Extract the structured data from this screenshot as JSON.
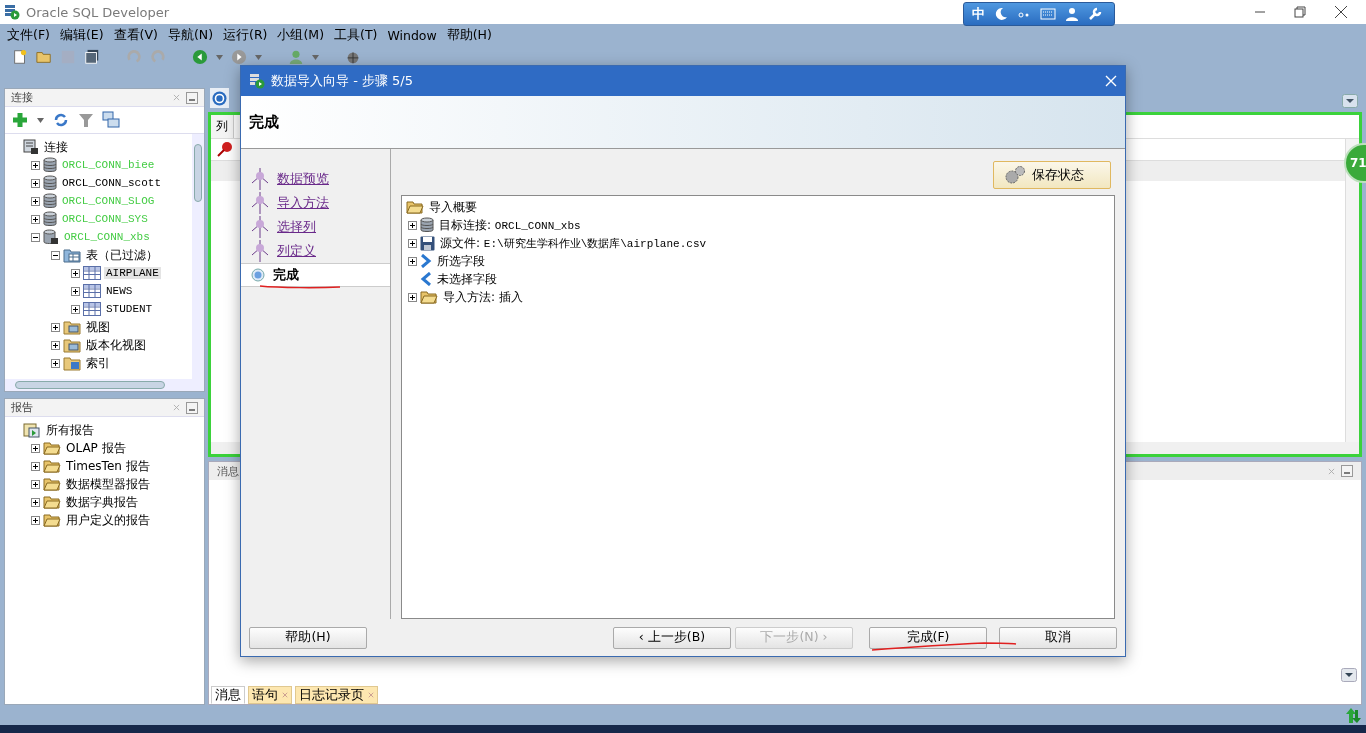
{
  "window": {
    "title": "Oracle SQL Developer"
  },
  "ime_bar": {
    "label": "中"
  },
  "menu": [
    "文件(F)",
    "编辑(E)",
    "查看(V)",
    "导航(N)",
    "运行(R)",
    "小组(M)",
    "工具(T)",
    "Window",
    "帮助(H)"
  ],
  "connections_panel": {
    "title": "连接",
    "tree": [
      {
        "label": "连接",
        "kind": "root",
        "selected": false,
        "children": [
          {
            "label": "ORCL_CONN_biee",
            "kind": "database",
            "expanded": false,
            "color": "#44cc44",
            "selected": false
          },
          {
            "label": "ORCL_CONN_scott",
            "kind": "database",
            "expanded": false,
            "color": "#000000",
            "selected": false
          },
          {
            "label": "ORCL_CONN_SLOG",
            "kind": "database",
            "expanded": false,
            "color": "#44cc44",
            "selected": false
          },
          {
            "label": "ORCL_CONN_SYS",
            "kind": "database",
            "expanded": false,
            "color": "#44cc44",
            "selected": false
          },
          {
            "label": "ORCL_CONN_xbs",
            "kind": "connection",
            "expanded": true,
            "color": "#44cc44",
            "selected": false,
            "children": [
              {
                "label": "表（已过滤）",
                "kind": "table-folder",
                "expanded": true,
                "selected": false,
                "children": [
                  {
                    "label": "AIRPLANE",
                    "kind": "table",
                    "expanded": false,
                    "selected": true
                  },
                  {
                    "label": "NEWS",
                    "kind": "table",
                    "expanded": false,
                    "selected": false
                  },
                  {
                    "label": "STUDENT",
                    "kind": "table",
                    "expanded": false,
                    "selected": false
                  }
                ]
              },
              {
                "label": "视图",
                "kind": "view-folder",
                "expanded": false,
                "selected": false
              },
              {
                "label": "版本化视图",
                "kind": "view-folder",
                "expanded": false,
                "selected": false
              },
              {
                "label": "索引",
                "kind": "index-folder",
                "expanded": false,
                "selected": false
              }
            ]
          }
        ]
      }
    ]
  },
  "reports_panel": {
    "title": "报告",
    "tree": [
      {
        "label": "所有报告",
        "kind": "report-root",
        "selected": false,
        "children": [
          {
            "label": "OLAP 报告",
            "kind": "folder",
            "expanded": false,
            "selected": false
          },
          {
            "label": "TimesTen 报告",
            "kind": "folder",
            "expanded": false,
            "selected": false
          },
          {
            "label": "数据模型器报告",
            "kind": "folder",
            "expanded": false,
            "selected": false
          },
          {
            "label": "数据字典报告",
            "kind": "folder",
            "expanded": false,
            "selected": false
          },
          {
            "label": "用户定义的报告",
            "kind": "folder",
            "expanded": false,
            "selected": false
          }
        ]
      }
    ]
  },
  "editor": {
    "column_tab": "列",
    "badge": "71"
  },
  "messages_panel": {
    "title": "消息",
    "tabs": [
      {
        "label": "消息",
        "selected": true,
        "closable": false
      },
      {
        "label": "语句",
        "selected": false,
        "closable": true
      },
      {
        "label": "日志记录页",
        "selected": false,
        "closable": true
      }
    ]
  },
  "dialog": {
    "title": "数据导入向导 - 步骤 5/5",
    "heading": "完成",
    "steps": [
      {
        "label": "数据预览",
        "selected": false
      },
      {
        "label": "导入方法",
        "selected": false
      },
      {
        "label": "选择列",
        "selected": false
      },
      {
        "label": "列定义",
        "selected": false
      },
      {
        "label": "完成",
        "selected": true
      }
    ],
    "save_button": "保存状态",
    "summary": {
      "label": "导入概要",
      "items": [
        {
          "kind": "database",
          "label": "目标连接:",
          "value": "ORCL_CONN_xbs",
          "expandable": true
        },
        {
          "kind": "file",
          "label": "源文件:",
          "value": "E:\\研究生学科作业\\数据库\\airplane.csv",
          "expandable": true
        },
        {
          "kind": "selected-fields",
          "label": "所选字段",
          "expandable": true
        },
        {
          "kind": "unselected-fields",
          "label": "未选择字段",
          "expandable": false
        },
        {
          "kind": "folder",
          "label": "导入方法:",
          "value": "插入",
          "expandable": true
        }
      ]
    },
    "buttons": [
      {
        "label": "帮助(H)",
        "disabled": false
      },
      {
        "label": "‹ 上一步(B)",
        "disabled": false
      },
      {
        "label": "下一步(N) ›",
        "disabled": true
      },
      {
        "label": "完成(F)",
        "disabled": false
      },
      {
        "label": "取消",
        "disabled": false
      }
    ]
  }
}
